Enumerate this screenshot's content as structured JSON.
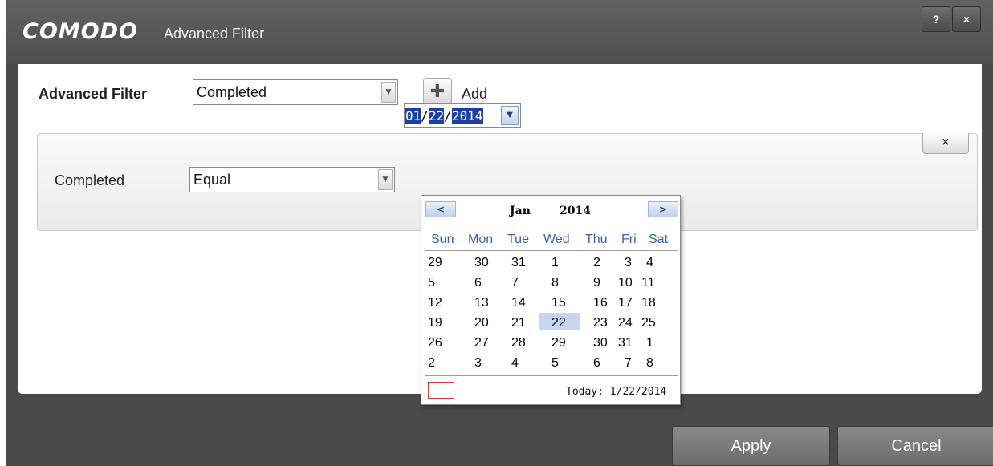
{
  "titlebar": {
    "brand": "COMODO",
    "title": "Advanced Filter",
    "help_label": "?",
    "close_label": "×"
  },
  "filter_row": {
    "label": "Advanced Filter",
    "selected": "Completed",
    "dropdown_arrow": "▼",
    "add_icon": "plus-icon",
    "add_label": "Add"
  },
  "condition": {
    "remove_label": "×",
    "field_label": "Completed",
    "operator": "Equal",
    "operator_arrow": "▼",
    "date": {
      "month": "01",
      "sep1": "/",
      "day": "22",
      "sep2": "/",
      "year": "2014",
      "picker_icon": "chevron-down-icon"
    }
  },
  "calendar": {
    "prev_label": "<",
    "next_label": ">",
    "month": "Jan",
    "year": "2014",
    "weekdays": [
      "Sun",
      "Mon",
      "Tue",
      "Wed",
      "Thu",
      "Fri",
      "Sat"
    ],
    "weeks": [
      [
        "29",
        "30",
        "31",
        "1",
        "2",
        "3",
        "4"
      ],
      [
        "5",
        "6",
        "7",
        "8",
        "9",
        "10",
        "11"
      ],
      [
        "12",
        "13",
        "14",
        "15",
        "16",
        "17",
        "18"
      ],
      [
        "19",
        "20",
        "21",
        "22",
        "23",
        "24",
        "25"
      ],
      [
        "26",
        "27",
        "28",
        "29",
        "30",
        "31",
        "1"
      ],
      [
        "2",
        "3",
        "4",
        "5",
        "6",
        "7",
        "8"
      ]
    ],
    "selected_day": "22",
    "today_text": "Today: 1/22/2014"
  },
  "footer": {
    "apply_label": "Apply",
    "cancel_label": "Cancel"
  },
  "colors": {
    "window_bg": "#4a4a4a",
    "selection": "#1c3fa8",
    "selected_day": "#c7d7f1",
    "weekday_text": "#3a5fb2",
    "today_marker": "#d93a3a"
  }
}
